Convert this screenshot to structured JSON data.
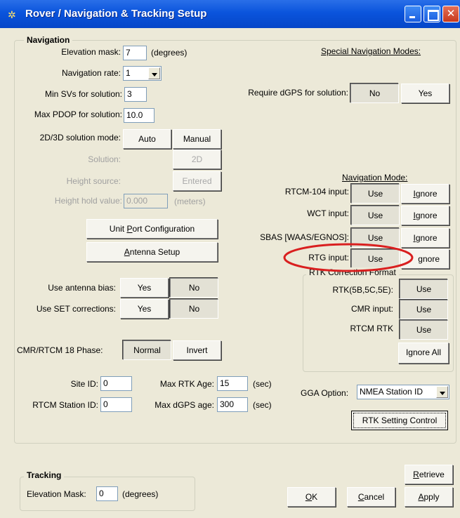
{
  "window": {
    "title": "Rover / Navigation & Tracking Setup"
  },
  "nav": {
    "group_title": "Navigation",
    "elevation_mask_label": "Elevation mask:",
    "elevation_mask_value": "7",
    "elevation_mask_unit": "(degrees)",
    "nav_rate_label": "Navigation rate:",
    "nav_rate_value": "1",
    "min_svs_label": "Min SVs for solution:",
    "min_svs_value": "3",
    "max_pdop_label": "Max PDOP for solution:",
    "max_pdop_value": "10.0",
    "mode_label": "2D/3D solution mode:",
    "mode_auto": "Auto",
    "mode_manual": "Manual",
    "solution_label": "Solution:",
    "solution_value": "2D",
    "height_source_label": "Height source:",
    "height_source_value": "Entered",
    "height_hold_label": "Height hold value:",
    "height_hold_value": "0.000",
    "height_hold_unit": "(meters)",
    "unit_port_label_pre": "Unit ",
    "unit_port_label_u": "P",
    "unit_port_label_post": "ort Configuration",
    "antenna_label_u": "A",
    "antenna_label_post": "ntenna Setup",
    "antenna_bias_label": "Use antenna bias:",
    "antenna_bias_yes": "Yes",
    "antenna_bias_no": "No",
    "set_corr_label": "Use SET corrections:",
    "set_corr_yes": "Yes",
    "set_corr_no": "No",
    "cmr_phase_label": "CMR/RTCM 18 Phase:",
    "cmr_normal": "Normal",
    "cmr_invert": "Invert",
    "site_id_label": "Site ID:",
    "site_id_value": "0",
    "rtcm_station_label": "RTCM Station ID:",
    "rtcm_station_value": "0",
    "max_rtk_label": "Max RTK Age:",
    "max_rtk_value": "15",
    "max_rtk_unit": "(sec)",
    "max_dgps_label": "Max dGPS age:",
    "max_dgps_value": "300",
    "max_dgps_unit": "(sec)"
  },
  "special": {
    "heading": "Special Navigation Modes:",
    "require_dgps_label": "Require dGPS for solution:",
    "require_no": "No",
    "require_yes": "Yes"
  },
  "navmode": {
    "heading": "Navigation Mode:",
    "rtcm104_label": "RTCM-104 input:",
    "wct_label": "WCT input:",
    "sbas_label": "SBAS [WAAS/EGNOS]:",
    "rtg_label": "RTG input:",
    "use": "Use",
    "ignore_u": "I",
    "ignore_post": "gnore",
    "ignore_rtg": "gnore"
  },
  "rtk": {
    "group_title": "RTK Correction Format",
    "rtk5b_label": "RTK(5B,5C,5E):",
    "cmr_label": "CMR input:",
    "rtcm_rtk_label": "RTCM RTK",
    "use": "Use",
    "ignore_all": "Ignore All"
  },
  "gga": {
    "label": "GGA Option:",
    "value": "NMEA Station ID"
  },
  "rtk_setting_button": "RTK Setting Control",
  "tracking": {
    "group_title": "Tracking",
    "elev_label": "Elevation Mask:",
    "elev_value": "0",
    "elev_unit": "(degrees)"
  },
  "footer": {
    "retrieve_u": "R",
    "retrieve_post": "etrieve",
    "ok_u": "O",
    "ok_post": "K",
    "cancel_u": "C",
    "cancel_post": "ancel",
    "apply_u": "A",
    "apply_post": "pply"
  },
  "colors": {
    "title_bar": "#0a54dc",
    "highlight_ellipse": "#d91f1f",
    "dialog_bg": "#ece9d8"
  }
}
